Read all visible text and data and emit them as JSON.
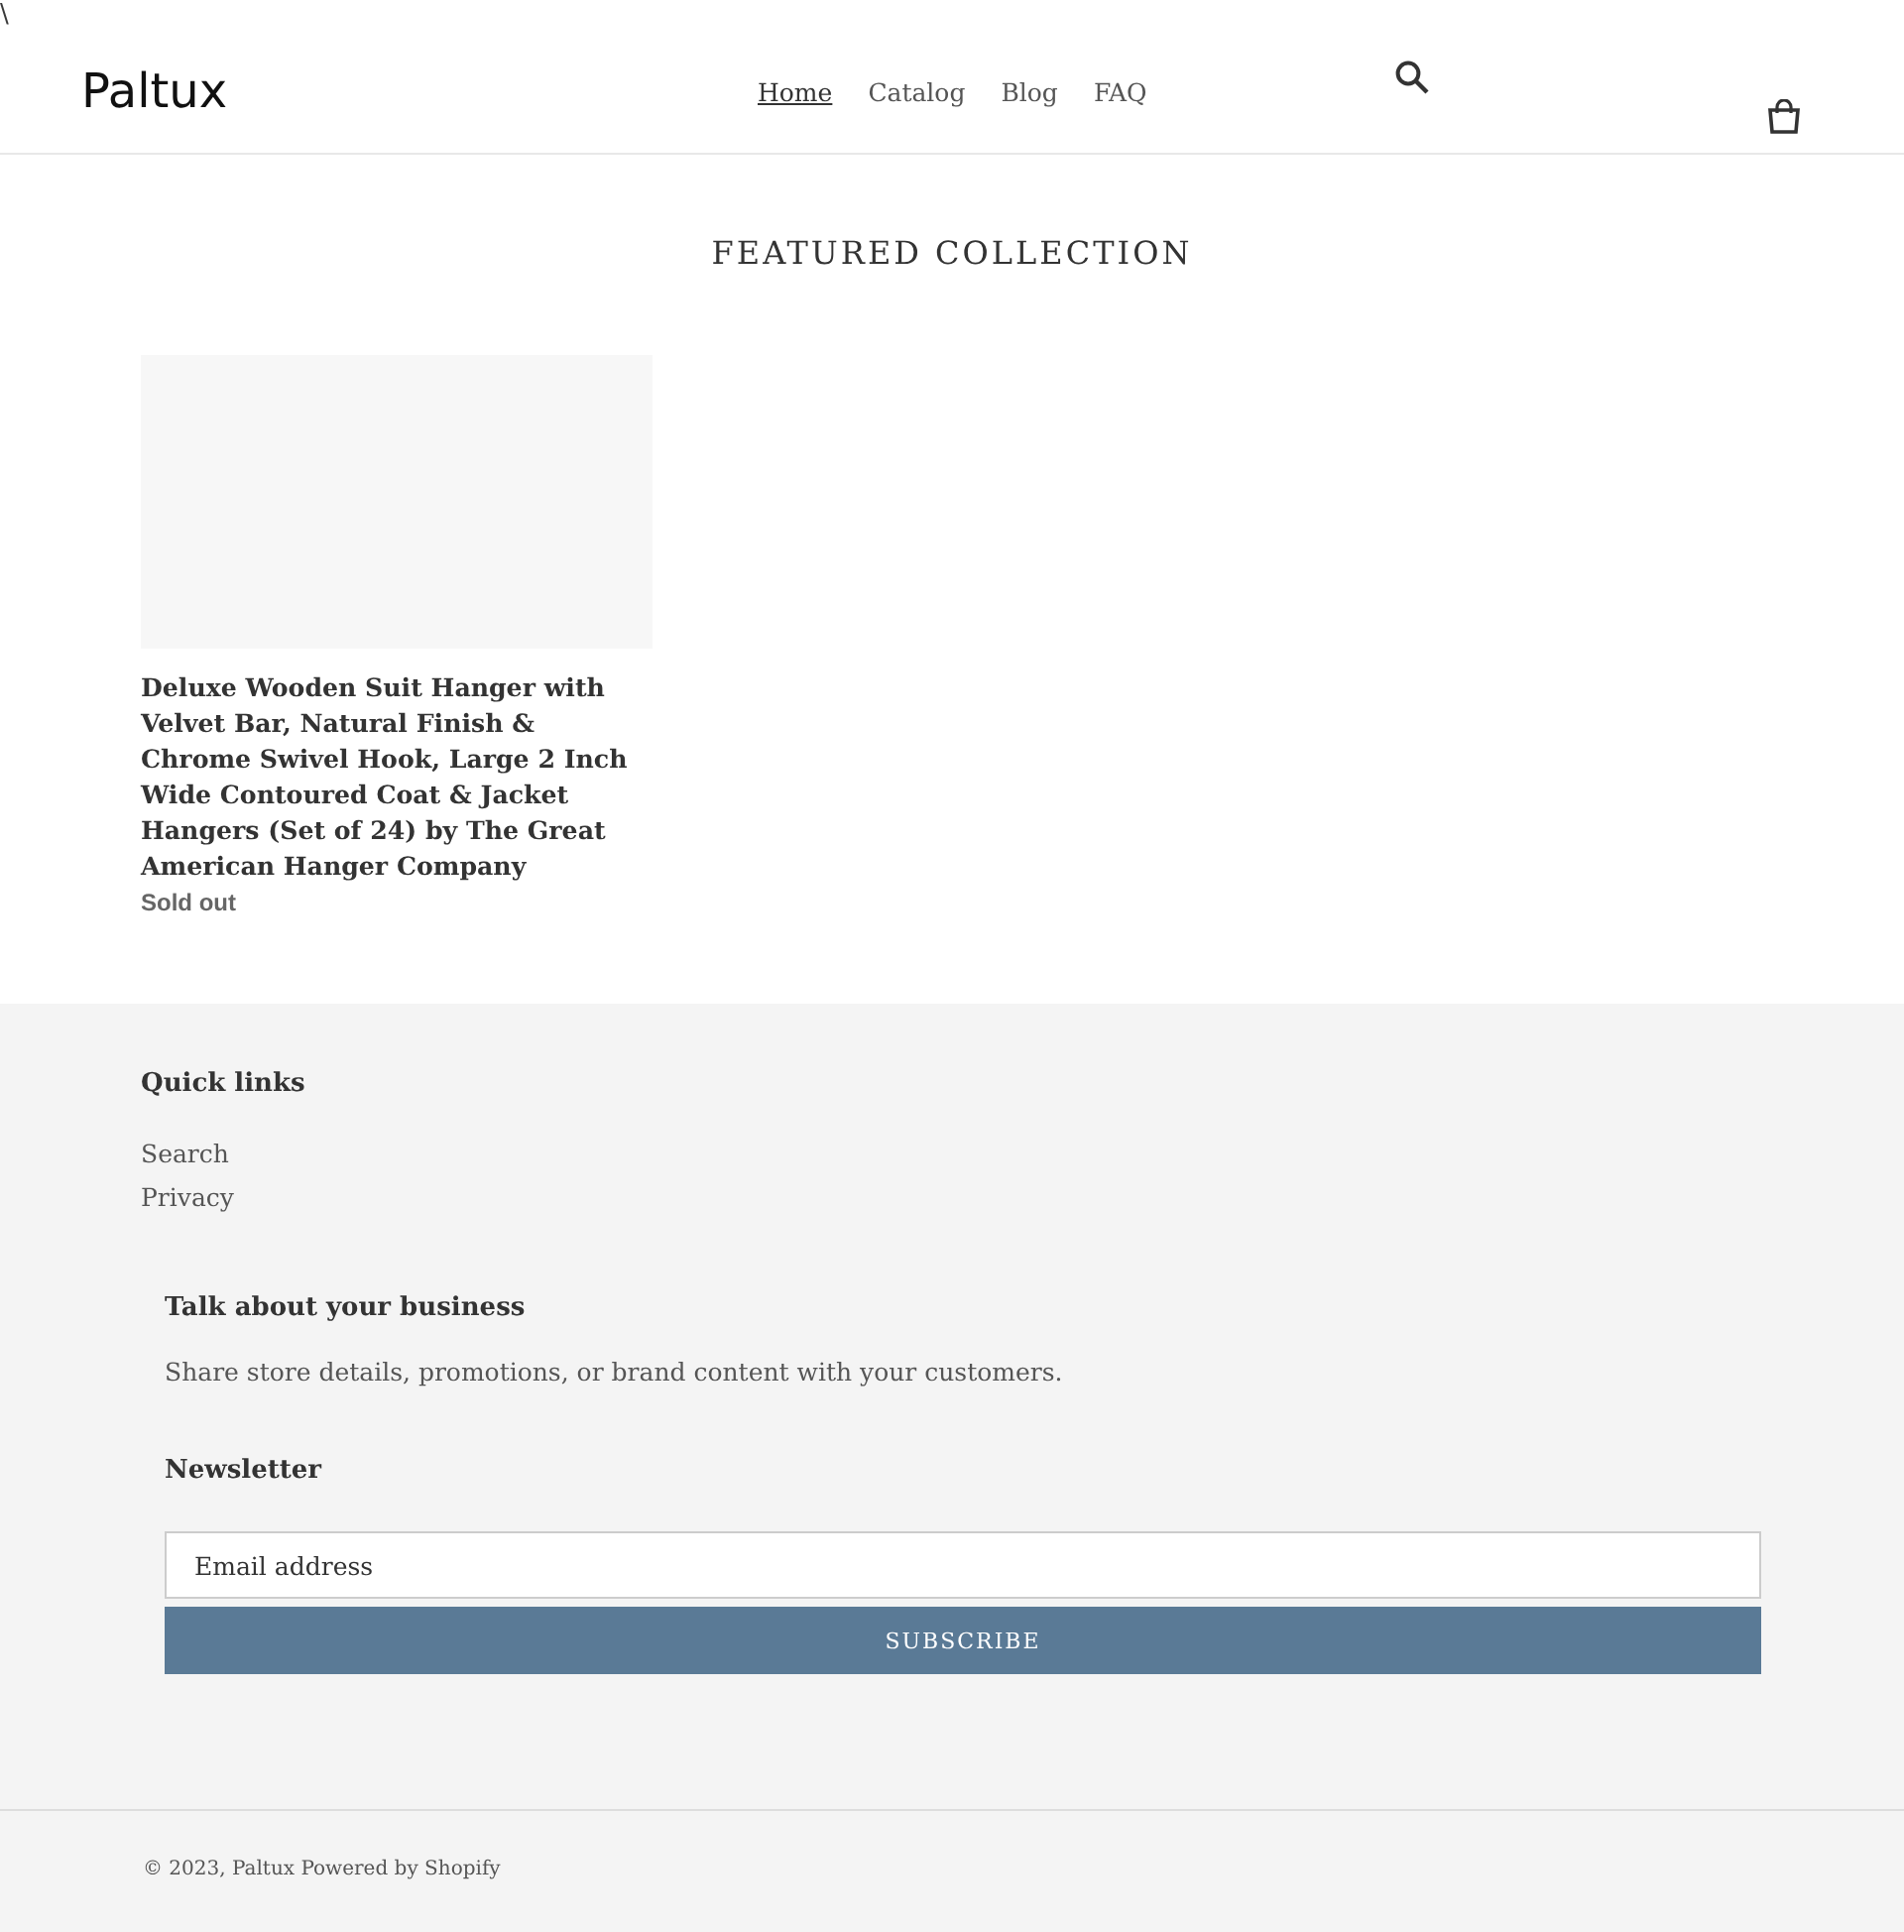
{
  "stray_text": "\\",
  "header": {
    "logo": "Paltux",
    "nav": [
      {
        "label": "Home",
        "selected": true
      },
      {
        "label": "Catalog",
        "selected": false
      },
      {
        "label": "Blog",
        "selected": false
      },
      {
        "label": "FAQ",
        "selected": false
      }
    ]
  },
  "featured": {
    "title": "FEATURED COLLECTION",
    "products": [
      {
        "title": "Deluxe Wooden Suit Hanger with Velvet Bar, Natural Finish & Chrome Swivel Hook, Large 2 Inch Wide Contoured Coat & Jacket Hangers (Set of 24) by The Great American Hanger Company",
        "status": "Sold out"
      }
    ]
  },
  "footer": {
    "quick_links": {
      "title": "Quick links",
      "links": [
        "Search",
        "Privacy"
      ]
    },
    "about": {
      "title": "Talk about your business",
      "text": "Share store details, promotions, or brand content with your customers."
    },
    "newsletter": {
      "title": "Newsletter",
      "placeholder": "Email address",
      "button": "SUBSCRIBE"
    },
    "copyright": "© 2023, Paltux Powered by Shopify"
  }
}
